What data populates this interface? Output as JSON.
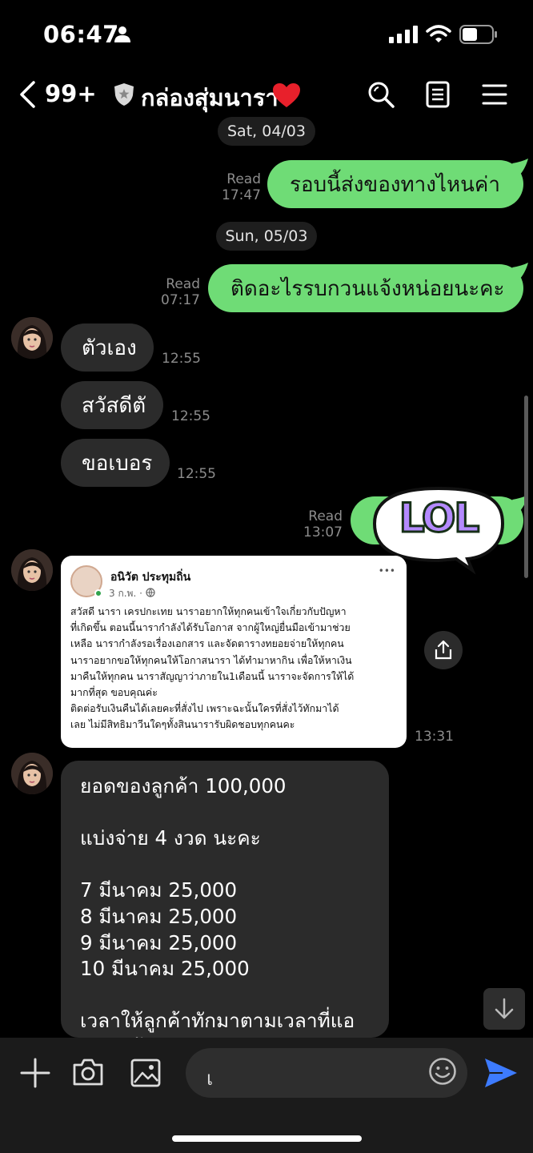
{
  "status": {
    "time": "06:47"
  },
  "header": {
    "unread_count": "99+",
    "title": "กล่องสุ่มนารา"
  },
  "dates": {
    "d1": "Sat, 04/03",
    "d2": "Sun, 05/03"
  },
  "messages": {
    "out1": {
      "text": "รอบนี้ส่งของทางไหนค่า",
      "status": "Read",
      "time": "17:47"
    },
    "out2": {
      "text": "ติดอะไรรบกวนแจ้งหน่อยนะคะ",
      "status": "Read",
      "time": "07:17"
    },
    "in1": {
      "text": "ตัวเอง",
      "time": "12:55"
    },
    "in2": {
      "text": "สวัสดีตั",
      "time": "12:55"
    },
    "in3": {
      "text": "ขอเบอร",
      "time": "12:55"
    },
    "sticker": {
      "text": "LOL",
      "status": "Read",
      "time": "13:07"
    },
    "post": {
      "author": "อนิวัต ประทุมถิ่น",
      "date": "3 ก.พ. ·",
      "more": "•••",
      "body": "สวัสดี นารา เครปกะเทย  นาราอยากให้ทุกคนเข้าใจเกี่ยวกับปัญหา\nที่เกิดขึ้น ตอนนี้นารากำลังได้รับโอกาส จากผู้ใหญ่ยื่นมือเข้ามาช่วย\nเหลือ นารากำลังรอเรื่องเอกสาร และจัดตารางทยอยจ่ายให้ทุกคน\nนาราอยากขอให้ทุกคนให้โอกาสนารา ได้ทำมาหากิน เพื่อให้หาเงิน\nมาคืนให้ทุกคน นาราสัญญาว่าภายใน1เดือนนี้ นาราจะจัดการให้ได้\nมากที่สุด ขอบคุณค่ะ\nติดต่อรับเงินคืนได้เลยคะที่สั่งไป เพราะฉะนั้นใครที่สั่งไว้ทักมาได้\nเลย ไม่มีสิทธิมาวีนใดๆทั้งสินนารารับผิดชอบทุกคนคะ",
      "time": "13:31"
    },
    "long": {
      "text": "ยอดของลูกค้า 100,000\n\nแบ่งจ่าย 4 งวด นะคะ\n\n7 มีนาคม 25,000\n8 มีนาคม 25,000\n9 มีนาคม  25,000\n10 มีนาคม 25,000\n\nเวลาให้ลูกค้าทักมาตามเวลาที่แอ\nดมินแจ้ง"
    }
  },
  "input": {
    "value": "เ"
  },
  "colors": {
    "outgoing": "#6fdc76",
    "incoming": "#2b2b2b",
    "send": "#3d7bff"
  }
}
